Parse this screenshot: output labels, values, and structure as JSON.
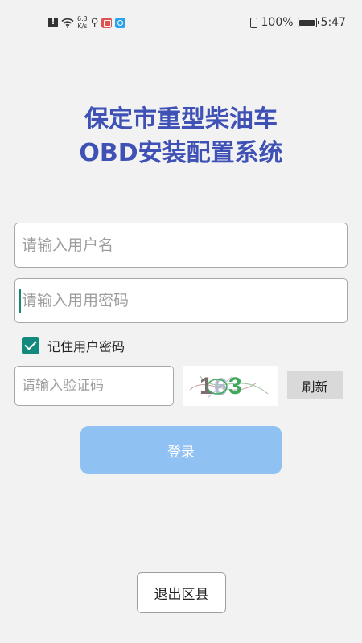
{
  "status_bar": {
    "network_speed_value": "6.3",
    "network_speed_unit": "K/s",
    "battery": "100%",
    "time": "5:47"
  },
  "title": {
    "line1": "保定市重型柴油车",
    "line2": "OBD安装配置系统"
  },
  "login_form": {
    "username_placeholder": "请输入用户名",
    "password_placeholder": "请输入用用密码",
    "remember_label": "记住用户密码",
    "remember_checked": true,
    "captcha_placeholder": "请输入验证码",
    "captcha_text": "163",
    "refresh_label": "刷新",
    "login_label": "登录"
  },
  "footer": {
    "exit_label": "退出区县"
  },
  "colors": {
    "title": "#3f51b5",
    "login_button": "#8fc1f3",
    "checkbox": "#12897c",
    "background": "#f2f2f2"
  }
}
